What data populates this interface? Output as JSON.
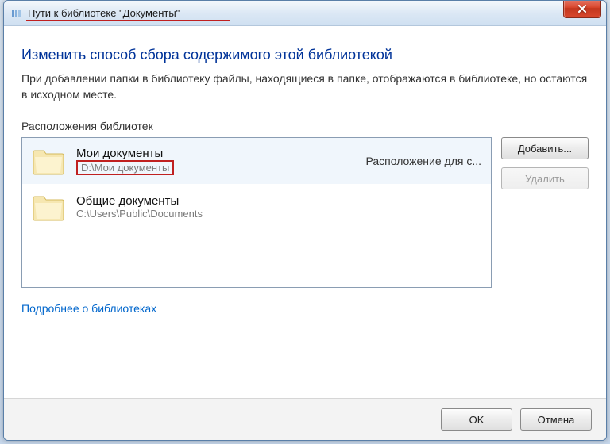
{
  "window": {
    "title": "Пути к библиотеке \"Документы\""
  },
  "heading": "Изменить способ сбора содержимого этой библиотекой",
  "description": "При добавлении папки в библиотеку файлы, находящиеся в папке, отображаются в библиотеке, но остаются в исходном месте.",
  "section_label": "Расположения библиотек",
  "buttons": {
    "add": "Добавить...",
    "remove": "Удалить",
    "ok": "OK",
    "cancel": "Отмена"
  },
  "link": "Подробнее о библиотеках",
  "locations": [
    {
      "name": "Мои документы",
      "path": "D:\\Мои документы",
      "meta": "Расположение для с...",
      "highlighted_path": true
    },
    {
      "name": "Общие документы",
      "path": "C:\\Users\\Public\\Documents",
      "meta": "",
      "highlighted_path": false
    }
  ]
}
